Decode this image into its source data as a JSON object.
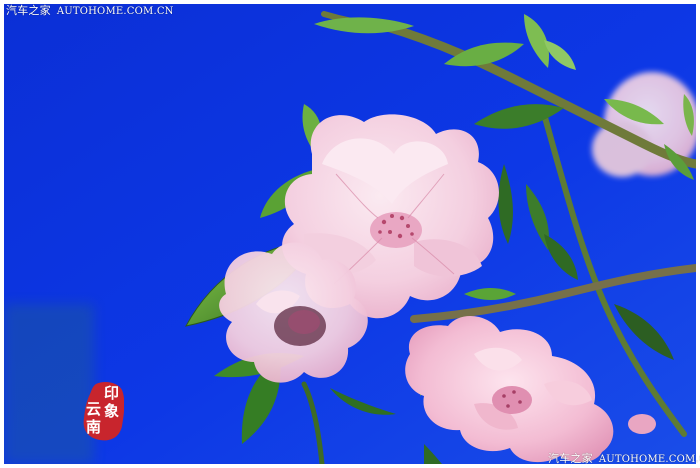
{
  "watermark": {
    "brand": "汽车之家",
    "site": "AUTOHOME.COM.CN"
  },
  "seal": {
    "chars": [
      "印",
      "象",
      "云",
      "南"
    ],
    "color": "#c8252d"
  },
  "colors": {
    "sky": "#0a2fd8",
    "sky_light": "#1f55f0",
    "petal": "#f6d9e6",
    "petal_shadow": "#e4a8c2",
    "leaf": "#4f9a2c",
    "branch": "#6d6a3a"
  }
}
